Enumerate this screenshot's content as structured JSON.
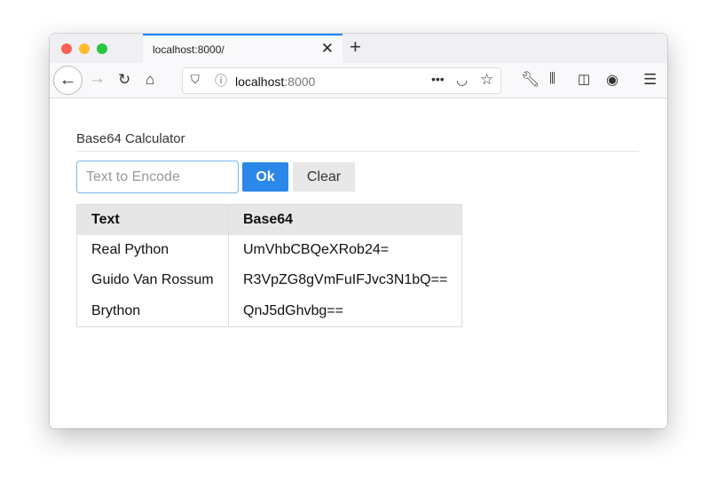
{
  "browser": {
    "tab_title": "localhost:8000/",
    "url_host": "localhost",
    "url_port": ":8000"
  },
  "page": {
    "title": "Base64 Calculator",
    "input_placeholder": "Text to Encode",
    "ok_label": "Ok",
    "clear_label": "Clear",
    "table": {
      "headers": [
        "Text",
        "Base64"
      ],
      "rows": [
        [
          "Real Python",
          "UmVhbCBQeXRob24="
        ],
        [
          "Guido Van Rossum",
          "R3VpZG8gVmFuIFJvc3N1bQ=="
        ],
        [
          "Brython",
          "QnJ5dGhvbg=="
        ]
      ]
    }
  }
}
